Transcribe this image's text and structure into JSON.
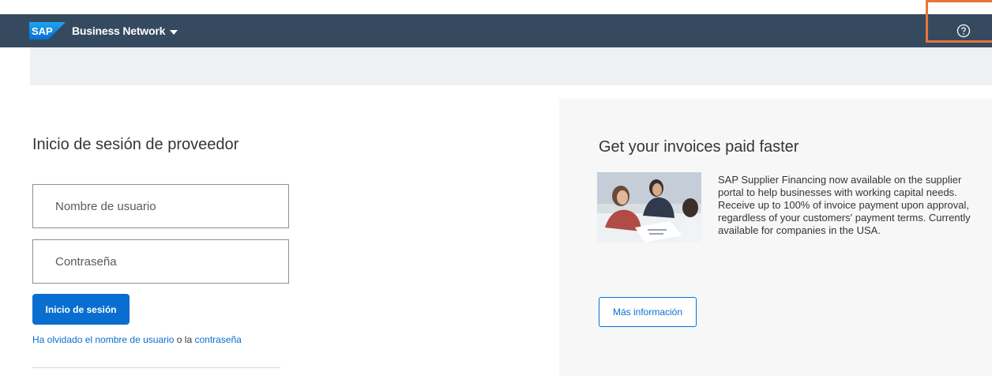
{
  "header": {
    "logo_text": "SAP",
    "brand_label": "Business Network",
    "help_icon": "help-circle-icon"
  },
  "login": {
    "title": "Inicio de sesión de proveedor",
    "username_placeholder": "Nombre de usuario",
    "password_placeholder": "Contraseña",
    "login_button": "Inicio de sesión",
    "forgot": {
      "link_username": "Ha olvidado el nombre de usuario",
      "connector": " o la ",
      "link_password": "contraseña"
    }
  },
  "promo": {
    "title": "Get your invoices paid faster",
    "body": "SAP Supplier Financing now available on the supplier portal to help businesses with working capital needs. Receive up to 100% of invoice payment upon approval, regardless of your customers' payment terms. Currently available for companies in the USA.",
    "more_button": "Más información"
  },
  "colors": {
    "header_bg": "#354a5f",
    "accent": "#0a6ed1",
    "highlight": "#e8753a"
  }
}
